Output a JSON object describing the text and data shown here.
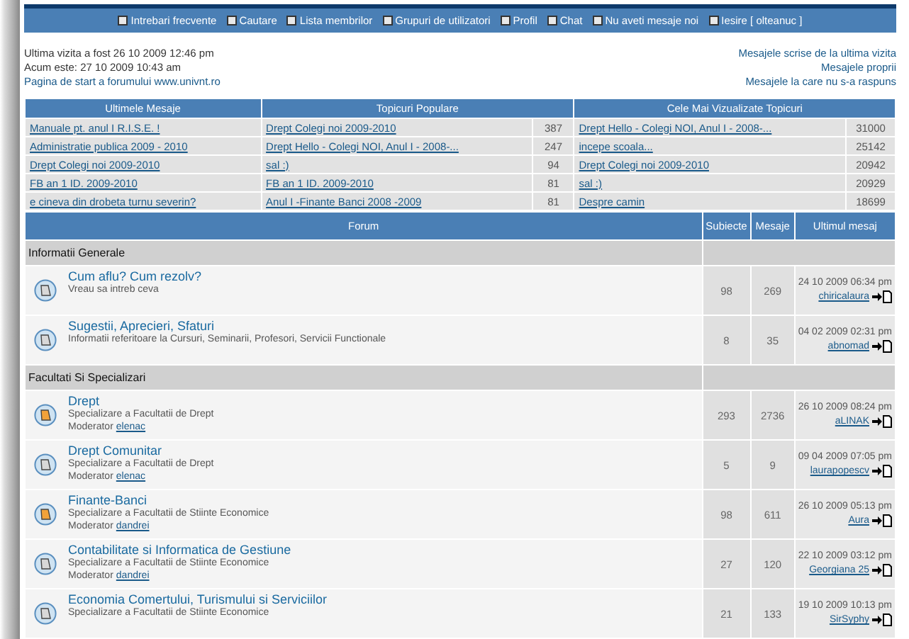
{
  "nav": [
    "Intrebari frecvente",
    "Cautare",
    "Lista membrilor",
    "Grupuri de utilizatori",
    "Profil",
    "Chat",
    "Nu aveti mesaje noi",
    "Iesire [ olteanuc ]"
  ],
  "info": {
    "last_visit": "Ultima vizita a fost 26 10 2009 12:46 pm",
    "now": "Acum este: 27 10 2009 10:43 am",
    "home_link": "Pagina de start a forumului www.univnt.ro",
    "links": [
      "Mesajele scrise de la ultima vizita",
      "Mesajele proprii",
      "Mesajele la care nu s-a raspuns"
    ]
  },
  "top_topics": {
    "columns": [
      "Ultimele Mesaje",
      "Topicuri Populare",
      "Cele Mai Vizualizate Topicuri"
    ],
    "rows": [
      {
        "latest": "Manuale pt. anul I R.I.S.E. !",
        "popular": "Drept Colegi noi 2009-2010",
        "popular_count": "387",
        "viewed": "Drept Hello - Colegi NOI, Anul I - 2008-...",
        "viewed_count": "31000"
      },
      {
        "latest": "Administratie publica 2009 - 2010",
        "popular": "Drept Hello - Colegi NOI, Anul I - 2008-...",
        "popular_count": "247",
        "viewed": "incepe scoala...",
        "viewed_count": "25142"
      },
      {
        "latest": "Drept Colegi noi 2009-2010",
        "popular": "sal :)",
        "popular_count": "94",
        "viewed": "Drept Colegi noi 2009-2010",
        "viewed_count": "20942"
      },
      {
        "latest": "FB an 1 ID. 2009-2010",
        "popular": "FB an 1 ID. 2009-2010",
        "popular_count": "81",
        "viewed": "sal :)",
        "viewed_count": "20929"
      },
      {
        "latest": "e cineva din drobeta turnu severin?",
        "popular": "Anul I -Finante Banci 2008 -2009",
        "popular_count": "81",
        "viewed": "Despre camin",
        "viewed_count": "18699"
      }
    ]
  },
  "forum_table": {
    "columns": [
      "Forum",
      "Subiecte",
      "Mesaje",
      "Ultimul mesaj"
    ],
    "categories": [
      {
        "title": "Informatii Generale",
        "forums": [
          {
            "name": "Cum aflu? Cum rezolv?",
            "description": "Vreau sa intreb ceva",
            "new_posts": false,
            "topics": "98",
            "posts": "269",
            "last_date": "24 10 2009 06:34 pm",
            "last_user": "chiricalaura"
          },
          {
            "name": "Sugestii, Aprecieri, Sfaturi",
            "description": "Informatii referitoare la Cursuri, Seminarii, Profesori, Servicii Functionale",
            "new_posts": false,
            "topics": "8",
            "posts": "35",
            "last_date": "04 02 2009 02:31 pm",
            "last_user": "abnomad"
          }
        ]
      },
      {
        "title": "Facultati Si Specializari",
        "forums": [
          {
            "name": "Drept",
            "description": "Specializare a Facultatii de Drept",
            "moderator_label": "Moderator",
            "moderator": "elenac",
            "new_posts": true,
            "topics": "293",
            "posts": "2736",
            "last_date": "26 10 2009 08:24 pm",
            "last_user": "aLINAK"
          },
          {
            "name": "Drept Comunitar",
            "description": "Specializare a Facultatii de Drept",
            "moderator_label": "Moderator",
            "moderator": "elenac",
            "new_posts": false,
            "topics": "5",
            "posts": "9",
            "last_date": "09 04 2009 07:05 pm",
            "last_user": "laurapopescv"
          },
          {
            "name": "Finante-Banci",
            "description": "Specializare a Facultatii de Stiinte Economice",
            "moderator_label": "Moderator",
            "moderator": "dandrei",
            "new_posts": true,
            "topics": "98",
            "posts": "611",
            "last_date": "26 10 2009 05:13 pm",
            "last_user": "Aura"
          },
          {
            "name": "Contabilitate si Informatica de Gestiune",
            "description": "Specializare a Facultatii de Stiinte Economice",
            "moderator_label": "Moderator",
            "moderator": "dandrei",
            "new_posts": false,
            "topics": "27",
            "posts": "120",
            "last_date": "22 10 2009 03:12 pm",
            "last_user": "Georgiana 25"
          },
          {
            "name": "Economia Comertului, Turismului si Serviciilor",
            "description": "Specializare a Facultatii de Stiinte Economice",
            "new_posts": false,
            "topics": "21",
            "posts": "133",
            "last_date": "19 10 2009 10:13 pm",
            "last_user": "SirSyphy"
          }
        ]
      }
    ]
  }
}
